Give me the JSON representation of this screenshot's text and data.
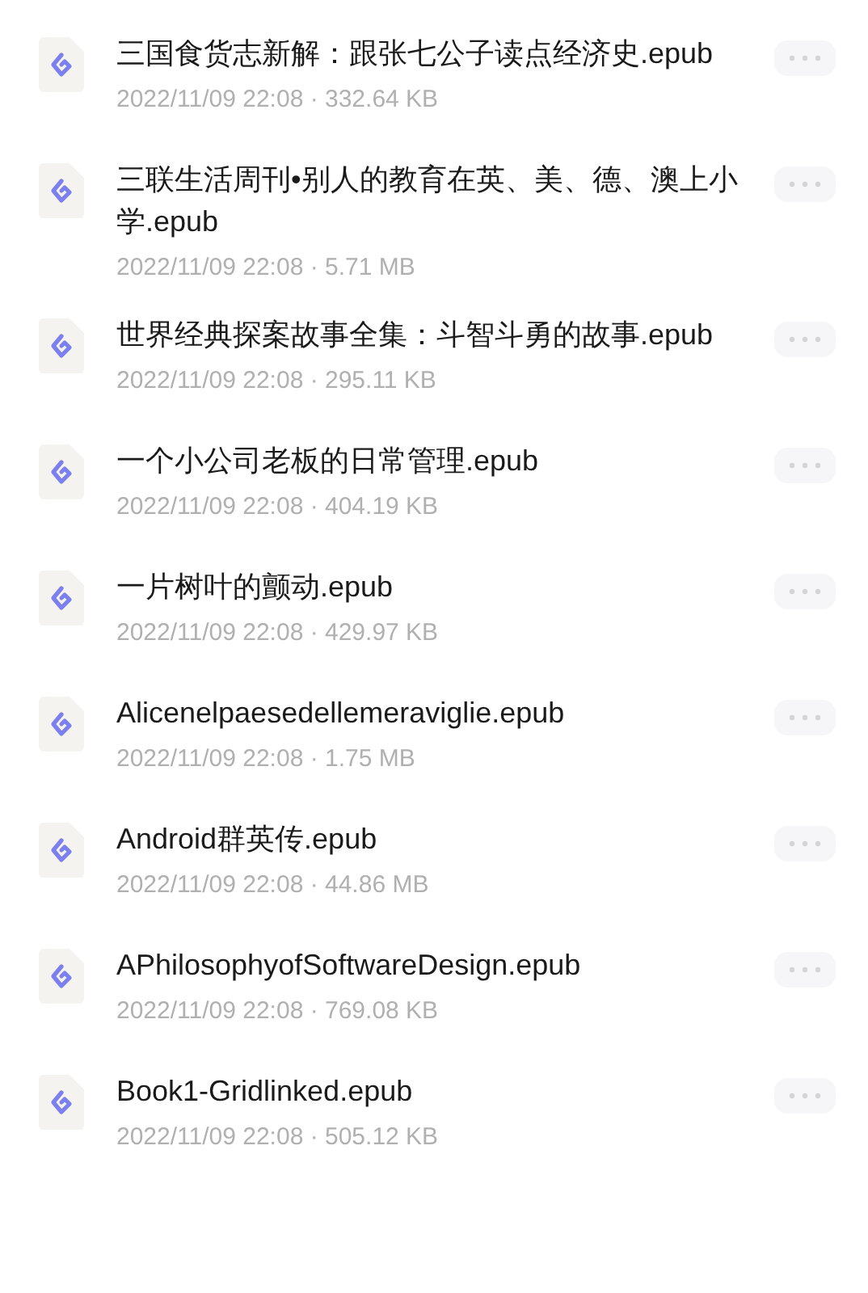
{
  "files": [
    {
      "name": "三国食货志新解：跟张七公子读点经济史.epub",
      "meta": "2022/11/09 22:08 · 332.64 KB"
    },
    {
      "name": "三联生活周刊•别人的教育在英、美、德、澳上小学.epub",
      "meta": "2022/11/09 22:08 · 5.71 MB"
    },
    {
      "name": "世界经典探案故事全集：斗智斗勇的故事.epub",
      "meta": "2022/11/09 22:08 · 295.11 KB"
    },
    {
      "name": "一个小公司老板的日常管理.epub",
      "meta": "2022/11/09 22:08 · 404.19 KB"
    },
    {
      "name": "一片树叶的颤动.epub",
      "meta": "2022/11/09 22:08 · 429.97 KB"
    },
    {
      "name": "Alicenelpaesedellemeraviglie.epub",
      "meta": "2022/11/09 22:08 · 1.75 MB"
    },
    {
      "name": "Android群英传.epub",
      "meta": "2022/11/09 22:08 · 44.86 MB"
    },
    {
      "name": "APhilosophyofSoftwareDesign.epub",
      "meta": "2022/11/09 22:08 · 769.08 KB"
    },
    {
      "name": "Book1-Gridlinked.epub",
      "meta": "2022/11/09 22:08 · 505.12 KB"
    }
  ]
}
